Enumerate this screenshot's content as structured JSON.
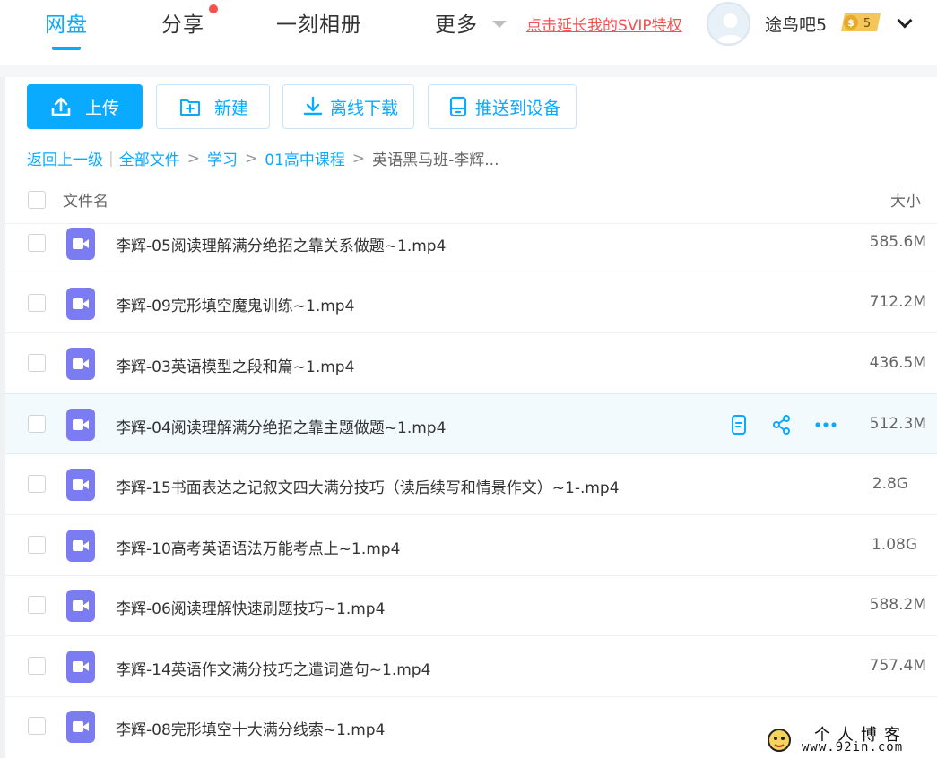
{
  "nav": {
    "tabs": [
      {
        "label": "网盘",
        "active": true
      },
      {
        "label": "分享",
        "has_dot": true
      },
      {
        "label": "一刻相册"
      },
      {
        "label": "更多"
      }
    ],
    "vip_link": "点击延长我的SVIP特权",
    "username": "途鸟吧5",
    "coin_badge": "5"
  },
  "toolbar": {
    "upload": "上传",
    "new": "新建",
    "offline_download": "离线下载",
    "push_to_device": "推送到设备"
  },
  "breadcrumb": {
    "back": "返回上一级",
    "items": [
      "全部文件",
      "学习",
      "01高中课程"
    ],
    "current": "英语黑马班-李辉..."
  },
  "list_header": {
    "name": "文件名",
    "size": "大小"
  },
  "files": [
    {
      "name": "李辉-05阅读理解满分绝招之靠关系做题~1.mp4",
      "size": "585.6M"
    },
    {
      "name": "李辉-09完形填空魔鬼训练~1.mp4",
      "size": "712.2M"
    },
    {
      "name": "李辉-03英语模型之段和篇~1.mp4",
      "size": "436.5M"
    },
    {
      "name": "李辉-04阅读理解满分绝招之靠主题做题~1.mp4",
      "size": "512.3M",
      "hovered": true
    },
    {
      "name": "李辉-15书面表达之记叙文四大满分技巧（读后续写和情景作文）~1-.mp4",
      "size": "2.8G"
    },
    {
      "name": "李辉-10高考英语语法万能考点上~1.mp4",
      "size": "1.08G"
    },
    {
      "name": "李辉-06阅读理解快速刷题技巧~1.mp4",
      "size": "588.2M"
    },
    {
      "name": "李辉-14英语作文满分技巧之遣词造句~1.mp4",
      "size": "757.4M"
    },
    {
      "name": "李辉-08完形填空十大满分线索~1.mp4",
      "size": ""
    }
  ],
  "watermark": {
    "title": "个人博客",
    "url": "www.92in.com"
  },
  "colors": {
    "accent": "#09aaff",
    "danger": "#f4514f",
    "video_icon": "#7b7cf2"
  }
}
